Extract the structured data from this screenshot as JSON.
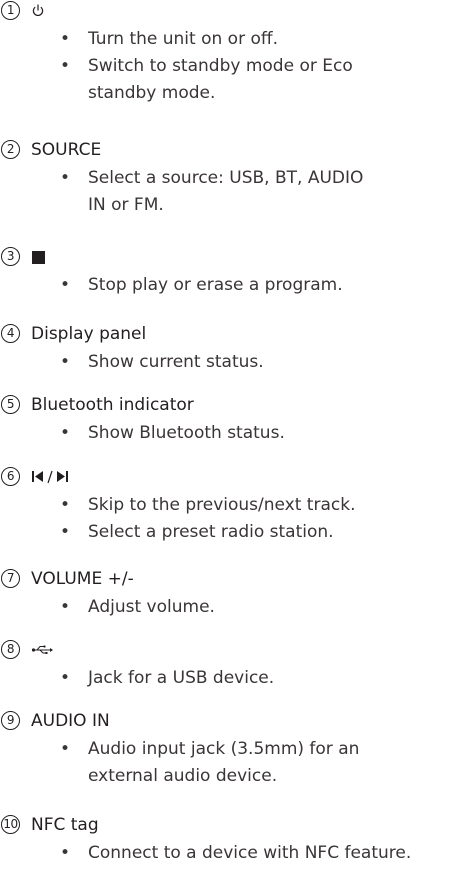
{
  "sections": [
    {
      "number": "1",
      "title": "",
      "icon": "power-icon",
      "bullets": [
        "Turn the unit on or off.",
        "Switch to standby mode or Eco standby mode."
      ]
    },
    {
      "number": "2",
      "title": "SOURCE",
      "bullets": [
        "Select a source: USB, BT, AUDIO IN or FM."
      ]
    },
    {
      "number": "3",
      "title": "",
      "icon": "stop-icon",
      "bullets": [
        "Stop play or erase a program."
      ]
    },
    {
      "number": "4",
      "title": "Display panel",
      "bullets": [
        "Show current status."
      ]
    },
    {
      "number": "5",
      "title": "Bluetooth indicator",
      "bullets": [
        "Show Bluetooth status."
      ]
    },
    {
      "number": "6",
      "title": "",
      "icon": "previous-next-icon",
      "bullets": [
        "Skip to the previous/next track.",
        "Select a preset radio station."
      ]
    },
    {
      "number": "7",
      "title": "VOLUME +/-",
      "bullets": [
        "Adjust volume."
      ]
    },
    {
      "number": "8",
      "title": "",
      "icon": "usb-icon",
      "bullets": [
        "Jack for a USB device."
      ]
    },
    {
      "number": "9",
      "title": "AUDIO IN",
      "bullets": [
        "Audio input jack (3.5mm) for an external audio device."
      ]
    },
    {
      "number": "10",
      "title": "NFC tag",
      "bullets": [
        "Connect to a device with NFC feature."
      ]
    }
  ],
  "bullet_glyph": "•"
}
